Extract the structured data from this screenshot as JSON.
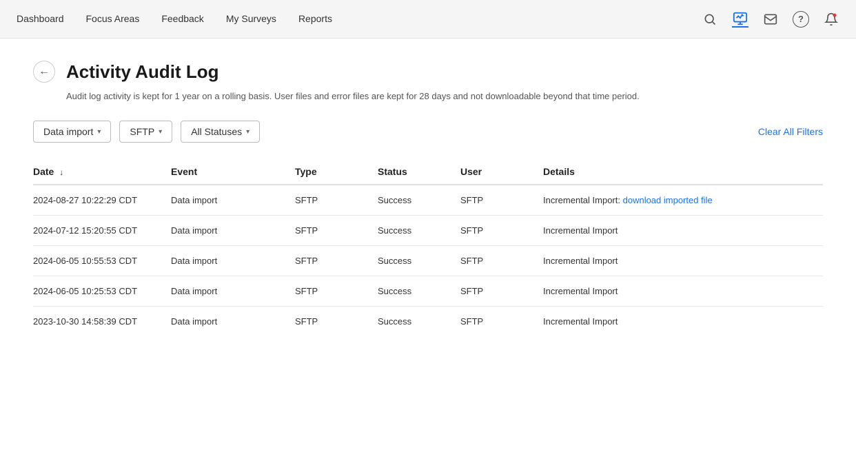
{
  "nav": {
    "links": [
      {
        "label": "Dashboard",
        "active": false
      },
      {
        "label": "Focus Areas",
        "active": false
      },
      {
        "label": "Feedback",
        "active": false
      },
      {
        "label": "My Surveys",
        "active": false
      },
      {
        "label": "Reports",
        "active": false
      }
    ],
    "icons": [
      {
        "name": "search-icon",
        "symbol": "🔍",
        "active": false
      },
      {
        "name": "analytics-icon",
        "symbol": "📊",
        "active": true
      },
      {
        "name": "mail-icon",
        "symbol": "✉",
        "active": false
      },
      {
        "name": "help-icon",
        "symbol": "?",
        "active": false,
        "circle": true
      },
      {
        "name": "notification-icon",
        "symbol": "🔔",
        "active": false
      }
    ]
  },
  "page": {
    "title": "Activity Audit Log",
    "subtitle": "Audit log activity is kept for 1 year on a rolling basis. User files and error files are kept for 28 days and not downloadable beyond that time period."
  },
  "filters": {
    "data_import_label": "Data import",
    "sftp_label": "SFTP",
    "all_statuses_label": "All Statuses",
    "clear_all_label": "Clear All Filters"
  },
  "table": {
    "columns": [
      {
        "key": "date",
        "label": "Date",
        "sortable": true
      },
      {
        "key": "event",
        "label": "Event",
        "sortable": false
      },
      {
        "key": "type",
        "label": "Type",
        "sortable": false
      },
      {
        "key": "status",
        "label": "Status",
        "sortable": false
      },
      {
        "key": "user",
        "label": "User",
        "sortable": false
      },
      {
        "key": "details",
        "label": "Details",
        "sortable": false
      }
    ],
    "rows": [
      {
        "date": "2024-08-27 10:22:29 CDT",
        "event": "Data import",
        "type": "SFTP",
        "status": "Success",
        "user": "SFTP",
        "details": "Incremental Import: ",
        "link_text": "download imported file",
        "has_link": true
      },
      {
        "date": "2024-07-12 15:20:55 CDT",
        "event": "Data import",
        "type": "SFTP",
        "status": "Success",
        "user": "SFTP",
        "details": "Incremental Import",
        "has_link": false
      },
      {
        "date": "2024-06-05 10:55:53 CDT",
        "event": "Data import",
        "type": "SFTP",
        "status": "Success",
        "user": "SFTP",
        "details": "Incremental Import",
        "has_link": false
      },
      {
        "date": "2024-06-05 10:25:53 CDT",
        "event": "Data import",
        "type": "SFTP",
        "status": "Success",
        "user": "SFTP",
        "details": "Incremental Import",
        "has_link": false
      },
      {
        "date": "2023-10-30 14:58:39 CDT",
        "event": "Data import",
        "type": "SFTP",
        "status": "Success",
        "user": "SFTP",
        "details": "Incremental Import",
        "has_link": false
      }
    ]
  }
}
